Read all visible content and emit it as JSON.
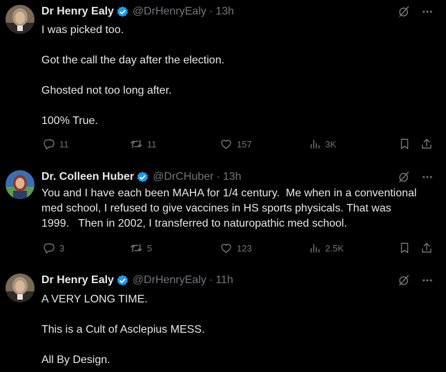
{
  "tweets": [
    {
      "name": "Dr Henry Ealy",
      "handle": "@DrHenryEaly",
      "dot": "·",
      "time": "13h",
      "paragraphs": [
        "I was picked too.",
        "Got the call the day after the election.",
        "Ghosted not too long after.",
        "100% True."
      ],
      "stats": {
        "replies": "11",
        "reposts": "11",
        "likes": "157",
        "views": "3K"
      }
    },
    {
      "name": "Dr. Colleen Huber",
      "handle": "@DrCHuber",
      "dot": "·",
      "time": "13h",
      "lines": [
        "You and I have each been MAHA for 1/4 century.  Me when in a conventional",
        "med school, I refused to give vaccines in HS sports physicals. That was",
        "1999.   Then in 2002, I transferred to naturopathic med school."
      ],
      "stats": {
        "replies": "3",
        "reposts": "5",
        "likes": "123",
        "views": "2.5K"
      }
    },
    {
      "name": "Dr Henry Ealy",
      "handle": "@DrHenryEaly",
      "dot": "·",
      "time": "11h",
      "paragraphs": [
        "A VERY LONG TIME.",
        "This is a Cult of Asclepius MESS.",
        "All By Design."
      ]
    }
  ],
  "icons": {
    "reply": "reply-icon",
    "repost": "repost-icon",
    "like": "heart-icon",
    "views": "views-icon",
    "bookmark": "bookmark-icon",
    "share": "share-icon",
    "grok": "grok-icon",
    "more": "more-icon",
    "verified": "verified-badge-icon"
  },
  "colors": {
    "background": "#000000",
    "text": "#e7e9ea",
    "muted": "#71767b",
    "verified": "#1d9bf0"
  }
}
